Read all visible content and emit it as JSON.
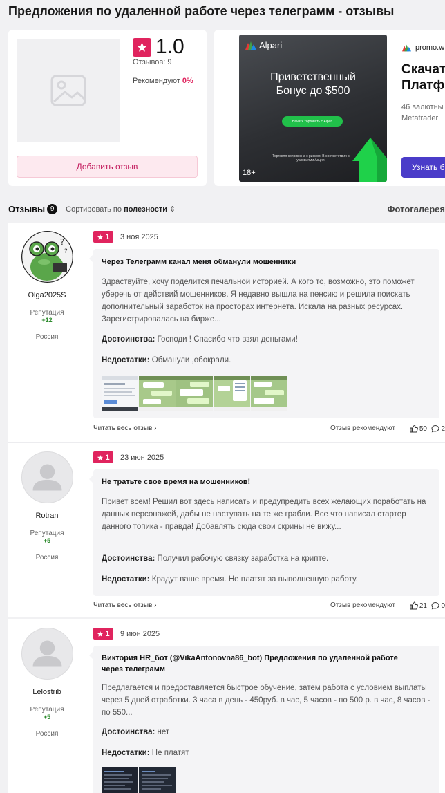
{
  "page": {
    "title": "Предложения по удаленной работе через телеграмм - отзывы"
  },
  "summary": {
    "rating": "1.0",
    "reviews_count": "Отзывов: 9",
    "recommend_label": "Рекомендуют",
    "recommend_pct": "0%",
    "add_review": "Добавить отзыв",
    "accent": "#e0245e"
  },
  "ad": {
    "brand": "Alpari",
    "headline_1": "Приветственный",
    "headline_2": "Бонус до $500",
    "cta": "Начать торговать с Alpari",
    "disclaimer": "Торговля сопряжена с риском. В соответствии с условиями Акции.",
    "age": "18+",
    "domain": "promo.w",
    "title_1": "Скачат",
    "title_2": "Платф",
    "sub_1": "46 валютны",
    "sub_2": "Metatrader",
    "button": "Узнать б"
  },
  "reviews_header": {
    "title": "Отзывы",
    "count": "9",
    "sort_prefix": "Сортировать по",
    "sort_by": "полезности",
    "photo_gallery": "Фотогалерея"
  },
  "reviews": [
    {
      "author": "Olga2025S",
      "reputation_label": "Репутация",
      "reputation": "+12",
      "country": "Россия",
      "rating": "1",
      "date": "3 ноя 2025",
      "title": "Через Телеграмм канал меня обманули мошенники",
      "text": "Здраствуйте, хочу поделится печальной историей. А кого то, возможно, это поможет уберечь от действий мошенников. Я недавно вышла на пенсию и решила поискать дополнительный заработок на просторах интернета. Искала на разных ресурсах. Зарегистрировалась на бирже...",
      "pros_label": "Достоинства:",
      "pros": "Господи ! Спасибо что взял деньгами!",
      "cons_label": "Недостатки:",
      "cons": "Обманули ,обокрали.",
      "read_more": "Читать весь отзыв",
      "recommend": "Отзыв рекомендуют",
      "likes": "50",
      "comments": "2"
    },
    {
      "author": "Rotran",
      "reputation_label": "Репутация",
      "reputation": "+5",
      "country": "Россия",
      "rating": "1",
      "date": "23 июн 2025",
      "title": "Не тратьте свое время на мошенников!",
      "text": "Привет всем! Решил вот здесь написать и предупредить всех желающих поработать на данных персонажей, дабы не наступать на те же грабли. Все что написал стартер данного топика - правда! Добавлять сюда свои скрины не вижу...",
      "pros_label": "Достоинства:",
      "pros": "Получил рабочую связку заработка на крипте.",
      "cons_label": "Недостатки:",
      "cons": "Крадут ваше время. Не платят за выполненную работу.",
      "read_more": "Читать весь отзыв",
      "recommend": "Отзыв рекомендуют",
      "likes": "21",
      "comments": "0"
    },
    {
      "author": "Lelostrib",
      "reputation_label": "Репутация",
      "reputation": "+5",
      "country": "Россия",
      "rating": "1",
      "date": "9 июн 2025",
      "title_1": "Виктория HR_бот (@VikaAntonovna86_bot) Предложения по удаленной работе",
      "title_2": "через телеграмм",
      "text": "Предлагается и предоставляется быстрое обучение, затем работа с условием выплаты через 5 дней отработки. 3 часа в день - 450руб. в час, 5 часов - по 500 р. в час, 8 часов - по 550...",
      "pros_label": "Достоинства:",
      "pros": "нет",
      "cons_label": "Недостатки:",
      "cons": "Не платят"
    }
  ]
}
